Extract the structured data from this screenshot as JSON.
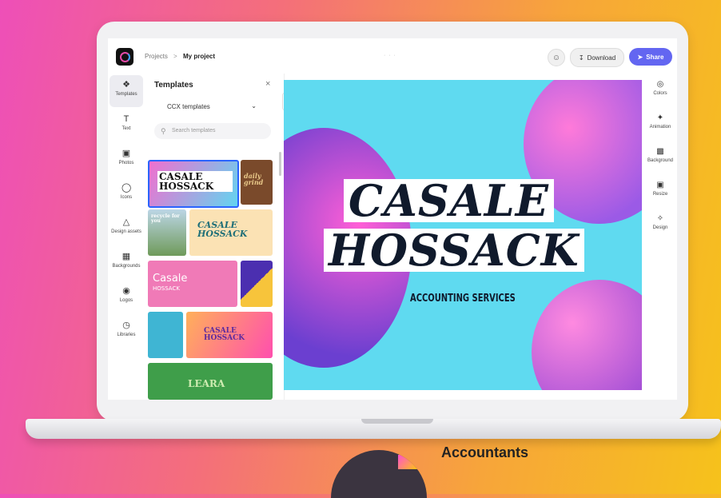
{
  "topbar": {
    "breadcrumb_root": "Projects",
    "breadcrumb_sep": ">",
    "breadcrumb_current": "My project",
    "center_title": "· · ·",
    "download_label": "Download",
    "share_label": "Share"
  },
  "left_rail": {
    "items": [
      {
        "label": "Templates",
        "icon": "templates-icon"
      },
      {
        "label": "Text",
        "icon": "text-icon"
      },
      {
        "label": "Photos",
        "icon": "photos-icon"
      },
      {
        "label": "Icons",
        "icon": "icons-icon"
      },
      {
        "label": "Design assets",
        "icon": "design-assets-icon"
      },
      {
        "label": "Backgrounds",
        "icon": "backgrounds-icon"
      },
      {
        "label": "Logos",
        "icon": "logos-icon"
      },
      {
        "label": "Libraries",
        "icon": "libraries-icon"
      }
    ]
  },
  "panel": {
    "title": "Templates",
    "close": "×",
    "dropdown_value": "CCX templates",
    "search_placeholder": "Search templates",
    "thumbs": {
      "t1": "CASALE HOSSACK",
      "t2": "daily grind",
      "t3": "recycle for you",
      "t4": "CASALE HOSSACK",
      "t5": "Casale",
      "t5b": "HOSSACK",
      "t7": "CASALE HOSSACK",
      "t8": "LEARA"
    }
  },
  "canvas": {
    "line1": "CASALE",
    "line2": "HOSSACK",
    "subtitle": "ACCOUNTING SERVICES"
  },
  "right_rail": {
    "items": [
      {
        "label": "Colors",
        "icon": "colors-icon"
      },
      {
        "label": "Animation",
        "icon": "animation-icon"
      },
      {
        "label": "Background",
        "icon": "background-icon"
      },
      {
        "label": "Resize",
        "icon": "resize-icon"
      },
      {
        "label": "Design",
        "icon": "design-icon"
      }
    ]
  },
  "footer": {
    "text": "Accountants"
  },
  "colors": {
    "accent": "#6366f1",
    "canvas_bg": "#5fdaf0",
    "headline_text": "#101a2c"
  }
}
